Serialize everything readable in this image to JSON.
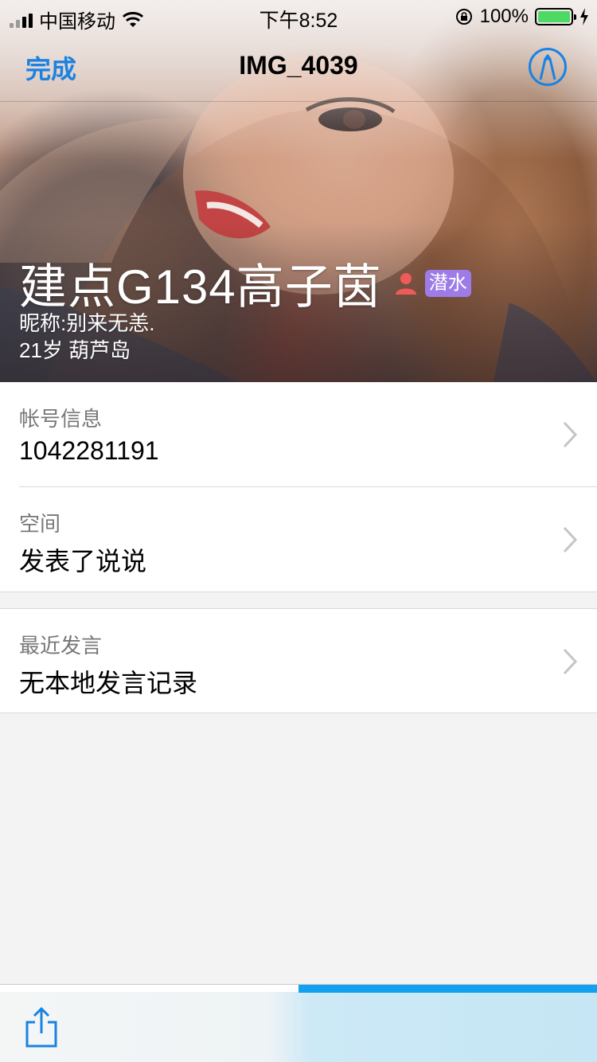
{
  "status_bar": {
    "carrier": "中国移动",
    "time": "下午8:52",
    "battery_percent": "100%",
    "battery_level": 1.0,
    "signal_bars_active": 2,
    "signal_bars_total": 4
  },
  "nav": {
    "done_label": "完成",
    "title": "IMG_4039"
  },
  "profile": {
    "name": "建点G134高子茵",
    "badge": "潜水",
    "nickname": "昵称:别来无恙.",
    "age_location": "21岁 葫芦岛"
  },
  "list": {
    "group1": [
      {
        "label": "帐号信息",
        "value": "1042281191"
      },
      {
        "label": "空间",
        "value": "发表了说说"
      }
    ],
    "group2": [
      {
        "label": "最近发言",
        "value": "无本地发言记录"
      }
    ]
  },
  "toolbar": {
    "progress": 0.5
  },
  "colors": {
    "accent": "#1a82e2",
    "badge": "#9d7ce8",
    "gender_icon": "#f05a5a",
    "progress": "#12a0f0",
    "battery": "#4cd964"
  },
  "icons": {
    "markup": "markup-pen-icon",
    "gender": "person-icon",
    "chevron": "chevron-right-icon",
    "share": "share-icon",
    "wifi": "wifi-icon",
    "orientation_lock": "orientation-lock-icon",
    "charging": "charging-bolt-icon"
  }
}
